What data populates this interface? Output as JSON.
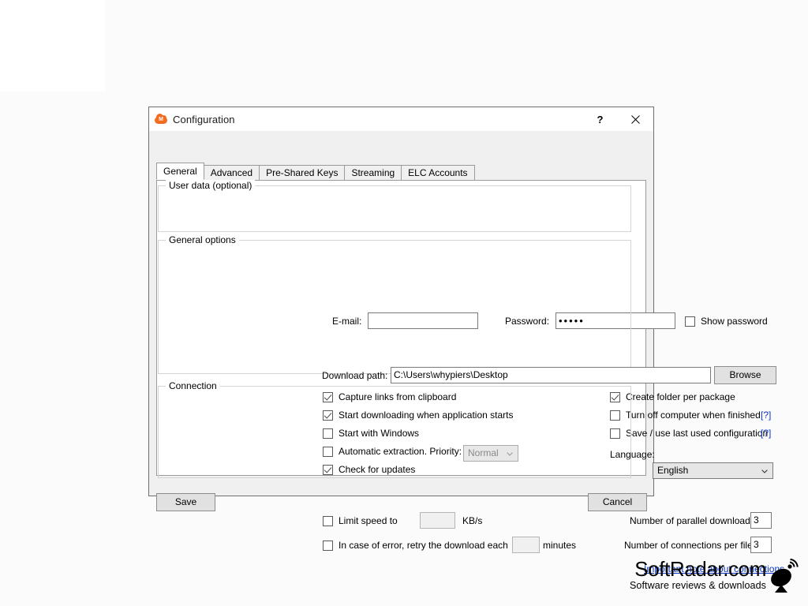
{
  "window": {
    "title": "Configuration",
    "icon": "cloud-icon",
    "help_button": "?",
    "close_button": "close-icon"
  },
  "tabs": [
    {
      "label": "General",
      "active": true
    },
    {
      "label": "Advanced",
      "active": false
    },
    {
      "label": "Pre-Shared Keys",
      "active": false
    },
    {
      "label": "Streaming",
      "active": false
    },
    {
      "label": "ELC Accounts",
      "active": false
    }
  ],
  "user_data": {
    "group_title": "User data (optional)",
    "email_label": "E-mail:",
    "email_value": "",
    "email_placeholder": "",
    "password_label": "Password:",
    "password_value": "•••••",
    "show_password_label": "Show password",
    "show_password_checked": false
  },
  "general_options": {
    "group_title": "General options",
    "download_path_label": "Download path:",
    "download_path_value": "C:\\Users\\whypiers\\Desktop",
    "browse_label": "Browse",
    "left_checkboxes": [
      {
        "label": "Capture links from clipboard",
        "checked": true
      },
      {
        "label": "Start downloading when application starts",
        "checked": true
      },
      {
        "label": "Start with Windows",
        "checked": false
      },
      {
        "label": "Automatic extraction. Priority:",
        "checked": false
      },
      {
        "label": "Check for updates",
        "checked": true
      }
    ],
    "priority_value": "Normal",
    "priority_enabled": false,
    "right_checkboxes": [
      {
        "label": "Create folder per package",
        "checked": true,
        "help": ""
      },
      {
        "label": "Turn off computer when finished",
        "checked": false,
        "help": "[?]"
      },
      {
        "label": "Save / use last used configuration",
        "checked": false,
        "help": "[?]"
      }
    ],
    "language_label": "Language:",
    "language_value": "English"
  },
  "connection": {
    "group_title": "Connection",
    "limit_speed_label": "Limit speed to",
    "limit_speed_checked": false,
    "limit_speed_value": "",
    "speed_unit": "KB/s",
    "retry_label": "In case of error, retry the download each",
    "retry_checked": false,
    "retry_value": "",
    "retry_unit": "minutes",
    "parallel_label": "Number of parallel downloads:",
    "parallel_value": "3",
    "connections_label": "Number of connections per file:",
    "connections_value": "3",
    "note_link": "Important note about connections"
  },
  "footer": {
    "save_label": "Save",
    "cancel_label": "Cancel"
  },
  "watermark": {
    "brand": "SoftRadar.com",
    "tagline": "Software reviews & downloads",
    "icon": "satellite-dish-icon"
  },
  "colors": {
    "accent_orange": "#f26d21",
    "link_blue": "#0a36c8",
    "dialog_face": "#f0f0f0",
    "panel_white": "#ffffff"
  }
}
